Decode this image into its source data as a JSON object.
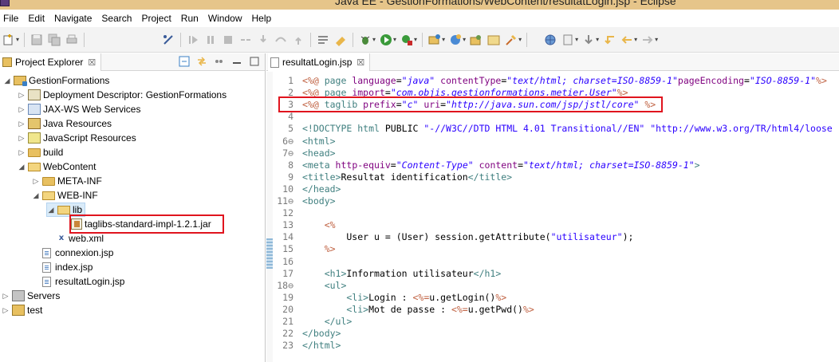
{
  "window": {
    "title": "Java EE - GestionFormations/WebContent/resultatLogin.jsp - Eclipse"
  },
  "menu": [
    "File",
    "Edit",
    "Navigate",
    "Search",
    "Project",
    "Run",
    "Window",
    "Help"
  ],
  "explorer": {
    "tab_label": "Project Explorer",
    "tab_close": "☒",
    "tree": [
      {
        "label": "GestionFormations",
        "icon": "project-icon",
        "toggle": "◢"
      },
      {
        "label": "Deployment Descriptor: GestionFormations",
        "icon": "deployment-descriptor-icon",
        "toggle": "▷"
      },
      {
        "label": "JAX-WS Web Services",
        "icon": "web-services-icon",
        "toggle": "▷"
      },
      {
        "label": "Java Resources",
        "icon": "java-resources-icon",
        "toggle": "▷"
      },
      {
        "label": "JavaScript Resources",
        "icon": "javascript-resources-icon",
        "toggle": "▷"
      },
      {
        "label": "build",
        "icon": "folder-icon",
        "toggle": "▷"
      },
      {
        "label": "WebContent",
        "icon": "folder-open-icon",
        "toggle": "◢"
      },
      {
        "label": "META-INF",
        "icon": "folder-icon",
        "toggle": "▷"
      },
      {
        "label": "WEB-INF",
        "icon": "folder-open-icon",
        "toggle": "◢"
      },
      {
        "label": "lib",
        "icon": "folder-open-icon",
        "toggle": "◢"
      },
      {
        "label": "taglibs-standard-impl-1.2.1.jar",
        "icon": "jar-icon",
        "toggle": ""
      },
      {
        "label": "web.xml",
        "icon": "xml-file-icon",
        "toggle": ""
      },
      {
        "label": "connexion.jsp",
        "icon": "jsp-file-icon",
        "toggle": ""
      },
      {
        "label": "index.jsp",
        "icon": "jsp-file-icon",
        "toggle": ""
      },
      {
        "label": "resultatLogin.jsp",
        "icon": "jsp-file-icon",
        "toggle": ""
      },
      {
        "label": "Servers",
        "icon": "servers-icon",
        "toggle": "▷"
      },
      {
        "label": "test",
        "icon": "project-icon",
        "toggle": "▷"
      }
    ]
  },
  "editor": {
    "tab_label": "resultatLogin.jsp",
    "tab_close": "☒",
    "line_numbers": [
      "1",
      "2",
      "3",
      "4",
      "5",
      "6⊖",
      "7⊖",
      "8",
      "9",
      "10",
      "11⊖",
      "12",
      "13",
      "14",
      "15",
      "16",
      "17",
      "18⊖",
      "19",
      "20",
      "21",
      "22",
      "23"
    ],
    "lines": [
      {
        "n": "1",
        "parts": [
          [
            "ds",
            "<%@ "
          ],
          [
            "kw",
            "page "
          ],
          [
            "at",
            "language"
          ],
          [
            "",
            "="
          ],
          [
            "av",
            "\"java\""
          ],
          [
            "",
            " "
          ],
          [
            "at",
            "contentType"
          ],
          [
            "",
            "="
          ],
          [
            "av",
            "\"text/html; charset=ISO-8859-1\""
          ],
          [
            "at",
            "pageEncoding"
          ],
          [
            "",
            "="
          ],
          [
            "av",
            "\"ISO-8859-1\""
          ],
          [
            "ds",
            "%>"
          ]
        ]
      },
      {
        "n": "2",
        "parts": [
          [
            "ds",
            "<%@ "
          ],
          [
            "kw",
            "page "
          ],
          [
            "at",
            "import"
          ],
          [
            "",
            "="
          ],
          [
            "av",
            "\"com.objis.gestionformations.metier.User\""
          ],
          [
            "ds",
            "%>"
          ]
        ]
      },
      {
        "n": "3",
        "parts": [
          [
            "ds",
            "<%@ "
          ],
          [
            "kw",
            "taglib "
          ],
          [
            "at",
            "prefix"
          ],
          [
            "",
            "="
          ],
          [
            "av",
            "\"c\""
          ],
          [
            "",
            " "
          ],
          [
            "at",
            "uri"
          ],
          [
            "",
            "="
          ],
          [
            "av",
            "\"http://java.sun.com/jsp/jstl/core\""
          ],
          [
            "",
            " "
          ],
          [
            "ds",
            "%>"
          ]
        ]
      },
      {
        "n": "4",
        "parts": []
      },
      {
        "n": "5",
        "parts": [
          [
            "tg",
            "<!DOCTYPE "
          ],
          [
            "tg",
            "html "
          ],
          [
            "",
            "PUBLIC "
          ],
          [
            "avn",
            "\"-//W3C//DTD HTML 4.01 Transitional//EN\""
          ],
          [
            "",
            " "
          ],
          [
            "avn",
            "\"http://www.w3.org/TR/html4/loose"
          ]
        ]
      },
      {
        "n": "6",
        "parts": [
          [
            "tg",
            "<html>"
          ]
        ]
      },
      {
        "n": "7",
        "parts": [
          [
            "tg",
            "<head>"
          ]
        ]
      },
      {
        "n": "8",
        "parts": [
          [
            "tg",
            "<meta "
          ],
          [
            "at",
            "http-equiv"
          ],
          [
            "",
            "="
          ],
          [
            "av",
            "\"Content-Type\""
          ],
          [
            "",
            " "
          ],
          [
            "at",
            "content"
          ],
          [
            "",
            "="
          ],
          [
            "av",
            "\"text/html; charset=ISO-8859-1\""
          ],
          [
            "tg",
            ">"
          ]
        ]
      },
      {
        "n": "9",
        "parts": [
          [
            "tg",
            "<title>"
          ],
          [
            "",
            "Resultat identification"
          ],
          [
            "tg",
            "</title>"
          ]
        ]
      },
      {
        "n": "10",
        "parts": [
          [
            "tg",
            "</head>"
          ]
        ]
      },
      {
        "n": "11",
        "parts": [
          [
            "tg",
            "<body>"
          ]
        ]
      },
      {
        "n": "12",
        "parts": []
      },
      {
        "n": "13",
        "parts": [
          [
            "",
            "    "
          ],
          [
            "ds",
            "<%"
          ]
        ]
      },
      {
        "n": "14",
        "parts": [
          [
            "",
            "        User u = (User) session.getAttribute("
          ],
          [
            "avn",
            "\"utilisateur\""
          ],
          [
            "",
            ");"
          ]
        ]
      },
      {
        "n": "15",
        "parts": [
          [
            "",
            "    "
          ],
          [
            "ds",
            "%>"
          ]
        ]
      },
      {
        "n": "16",
        "parts": []
      },
      {
        "n": "17",
        "parts": [
          [
            "",
            "    "
          ],
          [
            "tg",
            "<h1>"
          ],
          [
            "",
            "Information utilisateur"
          ],
          [
            "tg",
            "</h1>"
          ]
        ]
      },
      {
        "n": "18",
        "parts": [
          [
            "",
            "    "
          ],
          [
            "tg",
            "<ul>"
          ]
        ]
      },
      {
        "n": "19",
        "parts": [
          [
            "",
            "        "
          ],
          [
            "tg",
            "<li>"
          ],
          [
            "",
            "Login : "
          ],
          [
            "ds",
            "<%="
          ],
          [
            "",
            "u.getLogin()"
          ],
          [
            "ds",
            "%>"
          ]
        ]
      },
      {
        "n": "20",
        "parts": [
          [
            "",
            "        "
          ],
          [
            "tg",
            "<li>"
          ],
          [
            "",
            "Mot de passe : "
          ],
          [
            "ds",
            "<%="
          ],
          [
            "",
            "u.getPwd()"
          ],
          [
            "ds",
            "%>"
          ]
        ]
      },
      {
        "n": "21",
        "parts": [
          [
            "",
            "    "
          ],
          [
            "tg",
            "</ul>"
          ]
        ]
      },
      {
        "n": "22",
        "parts": [
          [
            "tg",
            "</body>"
          ]
        ]
      },
      {
        "n": "23",
        "parts": [
          [
            "tg",
            "</html>"
          ]
        ]
      }
    ]
  },
  "colors": {
    "highlight": "#e0141e",
    "directive": "#bf5f3f",
    "tag": "#3f7f7f",
    "attribute": "#7f007f",
    "attribute_value": "#2a00ff"
  }
}
